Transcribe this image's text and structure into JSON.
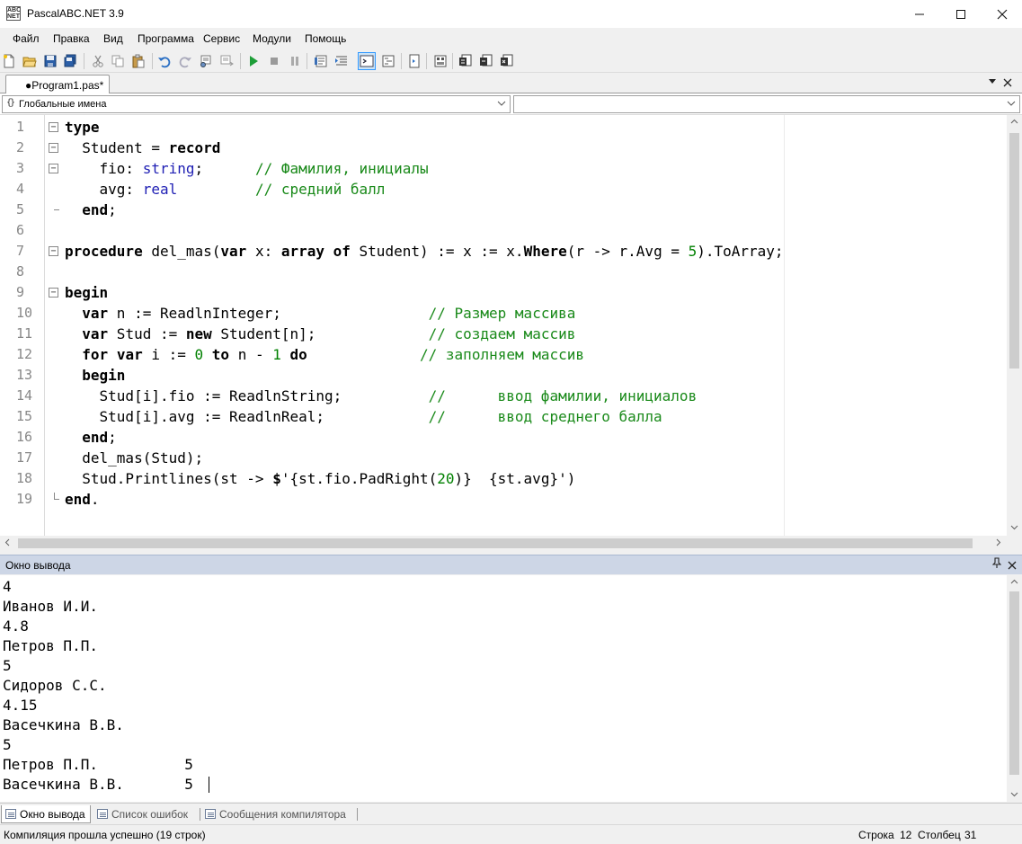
{
  "window": {
    "title": "PascalABC.NET 3.9",
    "icon_text": "ABC NET"
  },
  "menu": {
    "items": [
      "Файл",
      "Правка",
      "Вид",
      "Программа",
      "Сервис",
      "Модули",
      "Помощь"
    ]
  },
  "document_tab": {
    "label": "●Program1.pas*"
  },
  "navigation": {
    "scope_combo": "Глобальные имена",
    "member_combo": ""
  },
  "editor": {
    "line_numbers": [
      "1",
      "2",
      "3",
      "4",
      "5",
      "6",
      "7",
      "8",
      "9",
      "10",
      "11",
      "12",
      "13",
      "14",
      "15",
      "16",
      "17",
      "18",
      "19"
    ]
  },
  "output_pane": {
    "title": "Окно вывода",
    "lines": [
      "4",
      "Иванов И.И.",
      "4.8",
      "Петров П.П.",
      "5",
      "Сидоров С.С.",
      "4.15",
      "Васечкина В.В.",
      "5",
      "Петров П.П.          5",
      "Васечкина В.В.       5"
    ]
  },
  "bottom_tabs": [
    "Окно вывода",
    "Список ошибок",
    "Сообщения компилятора"
  ],
  "status": {
    "message": "Компиляция прошла успешно (19 строк)",
    "row_label": "Строка",
    "row_value": "12",
    "col_label": "Столбец",
    "col_value": "31"
  }
}
